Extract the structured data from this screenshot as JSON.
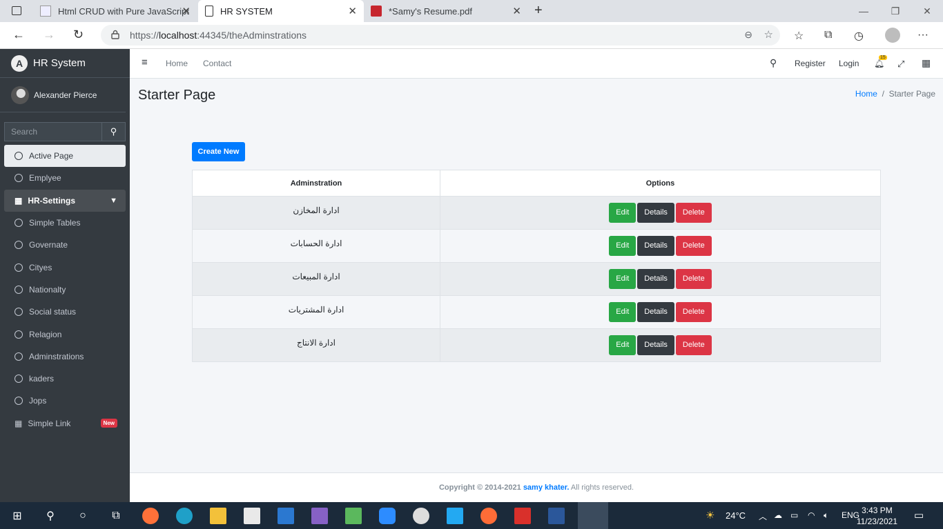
{
  "browser": {
    "tabs": [
      {
        "title": "Html CRUD with Pure JavaScript"
      },
      {
        "title": "HR SYSTEM"
      },
      {
        "title": "*Samy's Resume.pdf"
      }
    ],
    "url_prefix": "https://",
    "url_host": "localhost",
    "url_rest": ":44345/theAdminstrations"
  },
  "sidebar": {
    "brand": "HR System",
    "brand_initial": "A",
    "user": "Alexander Pierce",
    "search_placeholder": "Search",
    "items": [
      {
        "label": "Active Page"
      },
      {
        "label": "Emplyee"
      },
      {
        "label": "HR-Settings"
      },
      {
        "label": "Simple Tables"
      },
      {
        "label": "Governate"
      },
      {
        "label": "Cityes"
      },
      {
        "label": "Nationalty"
      },
      {
        "label": "Social status"
      },
      {
        "label": "Relagion"
      },
      {
        "label": "Adminstrations"
      },
      {
        "label": "kaders"
      },
      {
        "label": "Jops"
      },
      {
        "label": "Simple Link",
        "badge": "New"
      }
    ]
  },
  "topnav": {
    "home": "Home",
    "contact": "Contact",
    "register": "Register",
    "login": "Login",
    "notif_count": "15"
  },
  "page": {
    "title": "Starter Page",
    "crumb_home": "Home",
    "crumb_current": "Starter Page",
    "create_label": "Create New"
  },
  "table": {
    "headers": [
      "Adminstration",
      "Options"
    ],
    "rows": [
      "ادارة المخازن",
      "ادارة الحسابات",
      "ادارة المبيعات",
      "ادارة المشتريات",
      "ادارة الانتاج"
    ],
    "edit": "Edit",
    "details": "Details",
    "delete": "Delete"
  },
  "footer": {
    "copyright": "Copyright © 2014-2021",
    "author": "samy khater.",
    "rights": " All rights reserved."
  },
  "taskbar": {
    "weather": "24°C",
    "lang": "ENG",
    "time": "3:43 PM",
    "date": "11/23/2021"
  }
}
